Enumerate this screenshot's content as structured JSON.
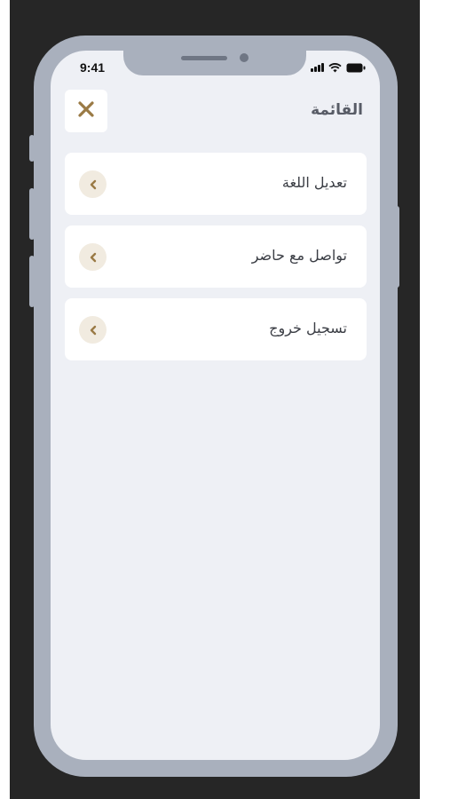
{
  "status_bar": {
    "time": "9:41",
    "icons": [
      "signal-icon",
      "wifi-icon",
      "battery-icon"
    ]
  },
  "header": {
    "title": "القائمة",
    "close_icon": "close-icon"
  },
  "menu": {
    "items": [
      {
        "label": "تعديل اللغة",
        "icon": "chevron-left-icon"
      },
      {
        "label": "تواصل مع حاضر",
        "icon": "chevron-left-icon"
      },
      {
        "label": "تسجيل خروج",
        "icon": "chevron-left-icon"
      }
    ]
  },
  "colors": {
    "accent": "#9a7a45",
    "chevron_bg": "#f1ebe0",
    "screen_bg": "#eef0f5",
    "card_bg": "#ffffff",
    "phone_frame": "#a9b0bd",
    "backdrop": "#262626"
  }
}
